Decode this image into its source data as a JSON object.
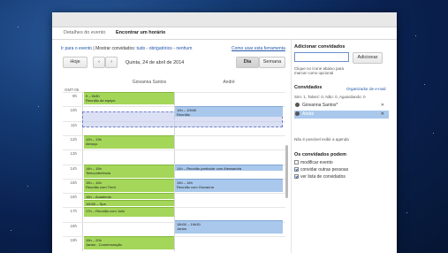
{
  "tabs": [
    {
      "label": "Detalhes do evento",
      "active": false
    },
    {
      "label": "Encontrar um horário",
      "active": true
    }
  ],
  "nav": {
    "back_link": "Ir para o evento",
    "show_guests_prefix": "Mostrar convidados:",
    "filter_all": "tudo",
    "filter_required": "obrigatórios",
    "filter_none": "nenhum",
    "help_link": "Como usar esta ferramenta"
  },
  "toolbar": {
    "today": "Hoje",
    "prev": "‹",
    "next": "›",
    "date": "Quinta, 24 de abril de 2014",
    "day": "Dia",
    "week": "Semana"
  },
  "columns": {
    "timezone": "GMT-05",
    "guest1": "Giovanna Santos",
    "guest2": "André"
  },
  "hours": [
    "9h",
    "10h",
    "11h",
    "12h",
    "13h",
    "14h",
    "15h",
    "16h",
    "17h",
    "18h",
    "19h"
  ],
  "events_guest1": [
    {
      "time": "9 – 9h30",
      "title": "Reunião da equipe"
    },
    {
      "time": "12h – 13h",
      "title": "Almoço"
    },
    {
      "time": "14h – 15h",
      "title": "Teleconferência"
    },
    {
      "time": "15h – 16h",
      "title": "Reunião com Trent"
    },
    {
      "time": "16h – Academia",
      "title": ""
    },
    {
      "time": "16h30 – Spa",
      "title": ""
    },
    {
      "time": "17h – Reunião com Julio",
      "title": ""
    },
    {
      "time": "19h – 20h",
      "title": "Jantar - Comemoração"
    }
  ],
  "events_guest2": [
    {
      "time": "10h – 10h30",
      "title": "Reunião"
    },
    {
      "time": "14h – Reunião particular com Alessandra",
      "title": ""
    },
    {
      "time": "15h – 16h",
      "title": "Reunião com Giovanna"
    },
    {
      "time": "18h30 – 19h30",
      "title": "Jantar"
    }
  ],
  "panel": {
    "add_title": "Adicionar convidados",
    "add_button": "Adicionar",
    "hint": "Clique no ícone abaixo para marcar como opcional",
    "guests_title": "Convidados",
    "organizer_link": "Organizador de e-mail",
    "rsvp": "Sim: 1, Talvez: 0, Não: 0, Aguardando: 0",
    "guests": [
      {
        "name": "Giovanna Santos*",
        "selected": false
      },
      {
        "name": "André",
        "selected": true
      }
    ],
    "agenda_note": "Não é possível exibir a agenda",
    "perm_title": "Os convidados podem",
    "perms": [
      {
        "label": "modificar evento",
        "checked": false
      },
      {
        "label": "convidar outras pessoas",
        "checked": true
      },
      {
        "label": "ver lista de convidados",
        "checked": true
      }
    ]
  },
  "colors": {
    "green_event": "#a4d65a",
    "blue_event": "#a9c8ec",
    "link": "#2255aa"
  }
}
